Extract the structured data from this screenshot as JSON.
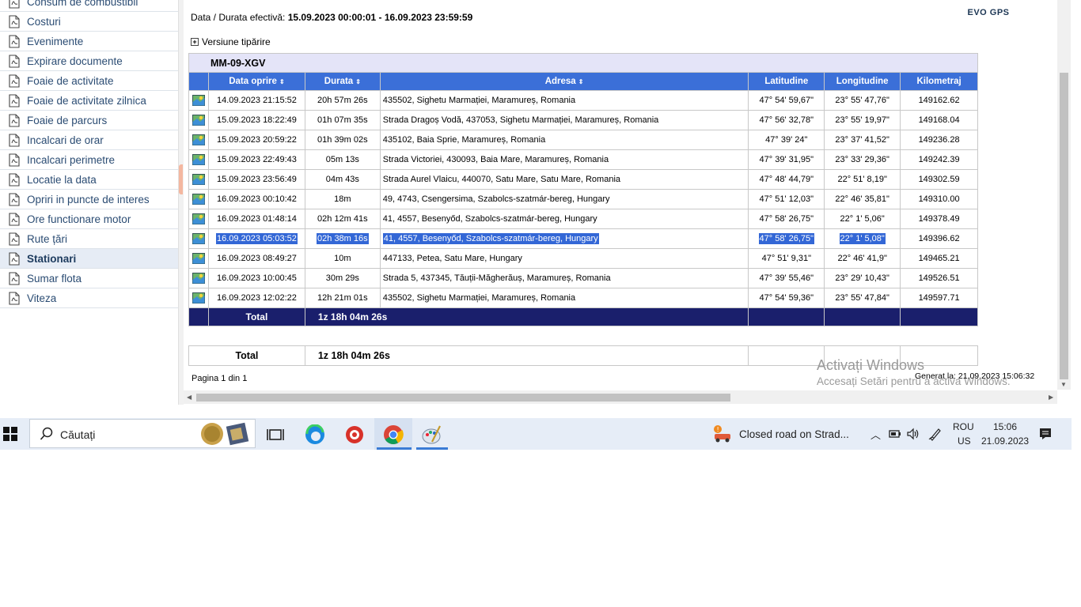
{
  "sidebar": {
    "items": [
      {
        "label": "Consum de combustibil"
      },
      {
        "label": "Costuri"
      },
      {
        "label": "Evenimente"
      },
      {
        "label": "Expirare documente"
      },
      {
        "label": "Foaie de activitate"
      },
      {
        "label": "Foaie de activitate zilnica"
      },
      {
        "label": "Foaie de parcurs"
      },
      {
        "label": "Incalcari de orar"
      },
      {
        "label": "Incalcari perimetre"
      },
      {
        "label": "Locatie la data"
      },
      {
        "label": "Opriri in puncte de interes"
      },
      {
        "label": "Ore functionare motor"
      },
      {
        "label": "Rute țări"
      },
      {
        "label": "Stationari"
      },
      {
        "label": "Sumar flota"
      },
      {
        "label": "Viteza"
      }
    ],
    "active": "Stationari"
  },
  "report": {
    "period_label": "Data / Durata efectivă:",
    "period_value": "15.09.2023 00:00:01 - 16.09.2023 23:59:59",
    "print_version": "Versiune tipărire",
    "logo": "EVO GPS",
    "plate": "MM-09-XGV",
    "columns": [
      "Data oprire",
      "Durata",
      "Adresa",
      "Latitudine",
      "Longitudine",
      "Kilometraj"
    ],
    "rows": [
      {
        "date": "14.09.2023 21:15:52",
        "duration": "20h 57m 26s",
        "address": "435502, Sighetu Marmației, Maramureș, Romania",
        "lat": "47° 54' 59,67\"",
        "lon": "23° 55' 47,76\"",
        "km": "149162.62"
      },
      {
        "date": "15.09.2023 18:22:49",
        "duration": "01h 07m 35s",
        "address": "Strada Dragoș Vodă,  437053, Sighetu Marmației, Maramureș, Romania",
        "lat": "47° 56' 32,78\"",
        "lon": "23° 55' 19,97\"",
        "km": "149168.04"
      },
      {
        "date": "15.09.2023 20:59:22",
        "duration": "01h 39m 02s",
        "address": "435102, Baia Sprie, Maramureș, Romania",
        "lat": "47° 39' 24\"",
        "lon": "23° 37' 41,52\"",
        "km": "149236.28"
      },
      {
        "date": "15.09.2023 22:49:43",
        "duration": "05m 13s",
        "address": "Strada Victoriei,  430093, Baia Mare, Maramureș, Romania",
        "lat": "47° 39' 31,95\"",
        "lon": "23° 33' 29,36\"",
        "km": "149242.39"
      },
      {
        "date": "15.09.2023 23:56:49",
        "duration": "04m 43s",
        "address": "Strada Aurel Vlaicu,  440070, Satu Mare, Satu Mare, Romania",
        "lat": "47° 48' 44,79\"",
        "lon": "22° 51' 8,19\"",
        "km": "149302.59"
      },
      {
        "date": "16.09.2023 00:10:42",
        "duration": "18m",
        "address": "49,  4743, Csengersima, Szabolcs-szatmár-bereg, Hungary",
        "lat": "47° 51' 12,03\"",
        "lon": "22° 46' 35,81\"",
        "km": "149310.00"
      },
      {
        "date": "16.09.2023 01:48:14",
        "duration": "02h 12m 41s",
        "address": "41,  4557, Besenyőd, Szabolcs-szatmár-bereg, Hungary",
        "lat": "47° 58' 26,75\"",
        "lon": "22° 1' 5,06\"",
        "km": "149378.49"
      },
      {
        "date": "16.09.2023 05:03:52",
        "duration": "02h 38m 16s",
        "address": "41,  4557, Besenyőd, Szabolcs-szatmár-bereg, Hungary",
        "lat": "47° 58' 26,75\"",
        "lon": "22° 1' 5,08\"",
        "km": "149396.62"
      },
      {
        "date": "16.09.2023 08:49:27",
        "duration": "10m",
        "address": "447133, Petea, Satu Mare, Hungary",
        "lat": "47° 51' 9,31\"",
        "lon": "22° 46' 41,9\"",
        "km": "149465.21"
      },
      {
        "date": "16.09.2023 10:00:45",
        "duration": "30m 29s",
        "address": "Strada 5,  437345, Tăuții-Măgherăuș, Maramureș, Romania",
        "lat": "47° 39' 55,46\"",
        "lon": "23° 29' 10,43\"",
        "km": "149526.51"
      },
      {
        "date": "16.09.2023 12:02:22",
        "duration": "12h 21m 01s",
        "address": "435502, Sighetu Marmației, Maramureș, Romania",
        "lat": "47° 54' 59,36\"",
        "lon": "23° 55' 47,84\"",
        "km": "149597.71"
      }
    ],
    "selected_row": 7,
    "total_label": "Total",
    "total_value": "1z 18h 04m 26s",
    "grand_total_label": "Total",
    "grand_total_value": "1z 18h 04m 26s",
    "page_info": "Pagina 1 din 1",
    "generated": "Generat la: 21.09.2023 15:06:32"
  },
  "watermark": {
    "line1": "Activați Windows",
    "line2": "Accesați Setări pentru a activa Windows."
  },
  "taskbar": {
    "search_placeholder": "Căutați",
    "notification": "Closed road on Strad...",
    "lang1": "ROU",
    "lang2": "US",
    "time": "15:06",
    "date": "21.09.2023"
  },
  "colors": {
    "header_blue": "#3b6fd8",
    "total_navy": "#1a1f6c",
    "selection": "#3367d6",
    "plate_row": "#e4e4f8"
  }
}
